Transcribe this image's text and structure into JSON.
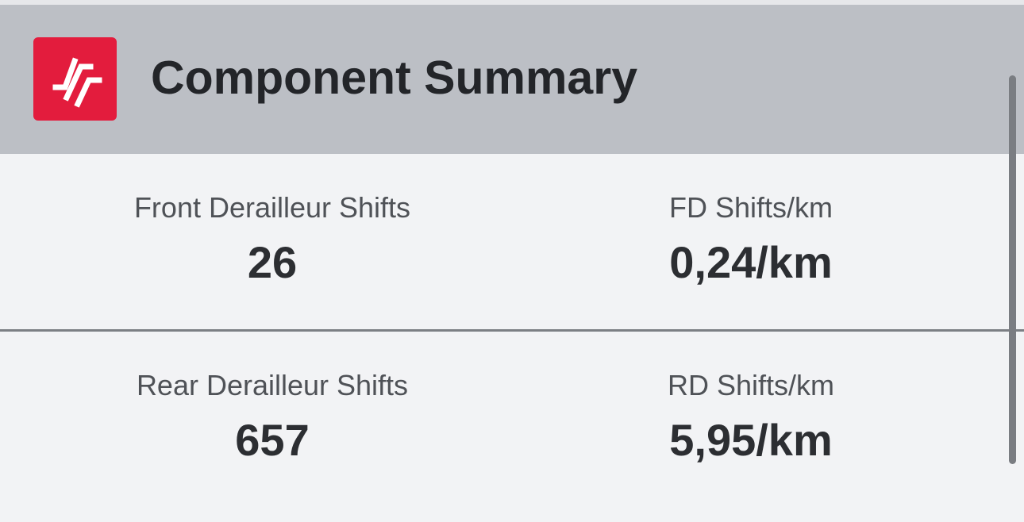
{
  "header": {
    "title": "Component Summary",
    "logo_icon": "brand-logo-icon",
    "logo_color": "#e31c3d",
    "background": "#bcbfc5"
  },
  "stats": [
    {
      "left": {
        "label": "Front Derailleur Shifts",
        "value": "26"
      },
      "right": {
        "label": "FD Shifts/km",
        "value": "0,24/km"
      }
    },
    {
      "left": {
        "label": "Rear Derailleur Shifts",
        "value": "657"
      },
      "right": {
        "label": "RD Shifts/km",
        "value": "5,95/km"
      }
    }
  ]
}
